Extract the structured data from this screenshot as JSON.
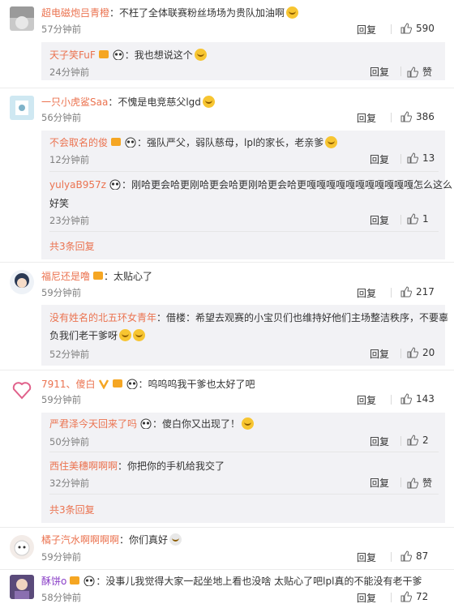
{
  "comments": [
    {
      "name": "超电磁炮吕青橙",
      "text": "：不枉了全体联赛粉丝场场为贵队加油啊",
      "time": "57分钟前",
      "reply": "回复",
      "likes": "590",
      "replies": [
        {
          "name": "天子笑FuF",
          "text": "：我也想说这个",
          "time": "24分钟前",
          "reply": "回复",
          "likes": "赞"
        }
      ]
    },
    {
      "name": "一只小虎鲨Saa",
      "text": "：不愧是电竞慈父lgd",
      "time": "56分钟前",
      "reply": "回复",
      "likes": "386",
      "replies": [
        {
          "name": "不会取名的俊",
          "text": "：强队严父，弱队慈母，lpl的家长，老亲爹",
          "time": "12分钟前",
          "reply": "回复",
          "likes": "13"
        },
        {
          "name": "yulyaB957z",
          "text": "：刚哈更会哈更刚哈更会哈更刚哈更会哈更嘎嘎嘎嘎嘎嘎嘎嘎嘎嘎嘎怎么这么",
          "text2": "好笑",
          "time": "23分钟前",
          "reply": "回复",
          "likes": "1"
        }
      ],
      "more": "共3条回复"
    },
    {
      "name": "福尼还是噜",
      "text": "：太贴心了",
      "time": "59分钟前",
      "reply": "回复",
      "likes": "217",
      "replies": [
        {
          "name": "没有姓名的北五环女青年",
          "text": "：借楼：希望去观赛的小宝贝们也维持好他们主场整洁秩序，不要辜",
          "text2": "负我们老干爹呀",
          "time": "52分钟前",
          "reply": "回复",
          "likes": "20"
        }
      ]
    },
    {
      "name": "7911、傻白",
      "text": "：呜呜呜我干爹也太好了吧",
      "time": "59分钟前",
      "reply": "回复",
      "likes": "143",
      "replies": [
        {
          "name": "严君泽今天回来了吗",
          "text": "：傻白你又出现了！",
          "time": "50分钟前",
          "reply": "回复",
          "likes": "2"
        },
        {
          "name": "西住美穗啊啊啊",
          "text": "：你把你的手机给我交了",
          "time": "32分钟前",
          "reply": "回复",
          "likes": "赞"
        }
      ],
      "more": "共3条回复"
    },
    {
      "name": "橘子汽水啊啊啊啊",
      "text": "：你们真好",
      "time": "59分钟前",
      "reply": "回复",
      "likes": "87",
      "replies": []
    },
    {
      "name": "酥饼o",
      "text": "：没事儿我觉得大家一起坐地上看也没啥 太贴心了吧lpl真的不能没有老干爹",
      "time": "58分钟前",
      "reply": "回复",
      "likes": "72",
      "replies": []
    }
  ]
}
